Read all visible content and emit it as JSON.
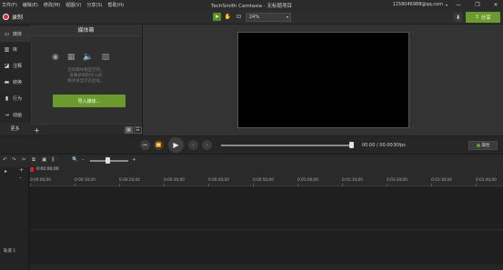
{
  "menu": [
    "文件(F)",
    "编辑(E)",
    "修改(M)",
    "视图(V)",
    "分享(S)",
    "帮助(H)"
  ],
  "app_title": "TechSmith Camtasia - 无标题项目",
  "account": "1158046988@qq.com",
  "window_controls": [
    "—",
    "❐",
    "✕"
  ],
  "toolbar": {
    "record_label": "录制",
    "zoom_value": "24%",
    "share_label": "分享"
  },
  "sidebar": {
    "items": [
      {
        "label": "媒体",
        "icon": "media-bin-icon"
      },
      {
        "label": "库",
        "icon": "library-icon"
      },
      {
        "label": "注释",
        "icon": "annotations-icon"
      },
      {
        "label": "转换",
        "icon": "transitions-icon"
      },
      {
        "label": "行为",
        "icon": "behaviors-icon"
      },
      {
        "label": "动画",
        "icon": "animations-icon"
      }
    ],
    "more_label": "更多"
  },
  "media_panel": {
    "title": "媒体箱",
    "empty_message": "您的媒体箱是空的。\n屏幕录制和导入的\n媒体将显示在此处。",
    "import_label": "导入媒体..."
  },
  "playback": {
    "timecode": "00:00 / 00:00",
    "fps": "30fps",
    "properties_label": "属性",
    "progress": 0.99
  },
  "timeline": {
    "playhead_time": "0:00:00;00",
    "ticks": [
      "0:00:00;00",
      "0:00:10;00",
      "0:00:20;00",
      "0:00:30;00",
      "0:00:40;00",
      "0:00:50;00",
      "0:01:00;00",
      "0:01:10;00",
      "0:01:20;00",
      "0:01:30;00",
      "0:01:40;00"
    ],
    "track_label": "轨道 1",
    "zoom_level": 0.45
  }
}
